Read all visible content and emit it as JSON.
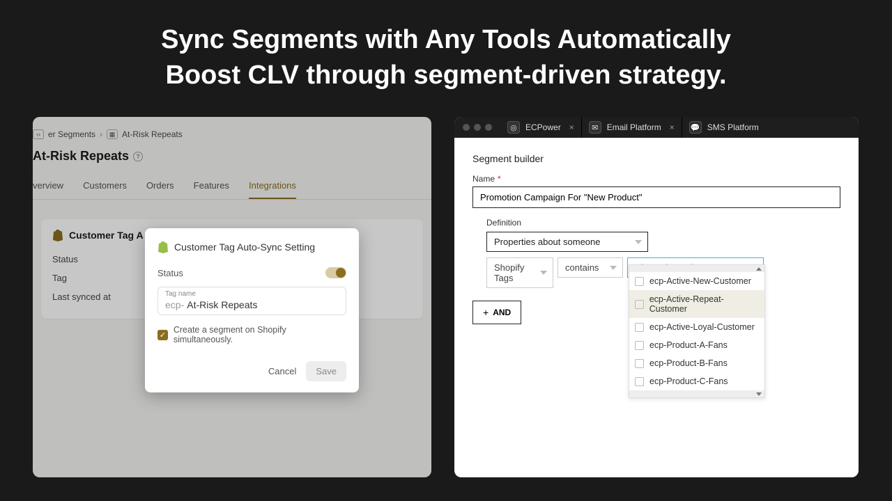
{
  "headline": {
    "line1": "Sync Segments with Any Tools Automatically",
    "line2": "Boost CLV through segment-driven strategy."
  },
  "left": {
    "breadcrumb": {
      "root": "er Segments",
      "current": "At-Risk Repeats"
    },
    "page_title": "At-Risk Repeats",
    "tabs": {
      "overview": "verview",
      "customers": "Customers",
      "orders": "Orders",
      "features": "Features",
      "integrations": "Integrations"
    },
    "card": {
      "title": "Customer Tag A",
      "row_status": "Status",
      "row_tag": "Tag",
      "row_last": "Last synced at"
    },
    "modal": {
      "title": "Customer Tag Auto-Sync Setting",
      "status_label": "Status",
      "tagname_label": "Tag name",
      "tag_prefix": "ecp-",
      "tag_value": "At-Risk Repeats",
      "create_segment": "Create a segment on Shopify simultaneously.",
      "cancel": "Cancel",
      "save": "Save"
    }
  },
  "right": {
    "tabs": {
      "ecpower": "ECPower",
      "email": "Email Platform",
      "sms": "SMS Platform"
    },
    "builder": {
      "title": "Segment builder",
      "name_label": "Name",
      "name_value": "Promotion Campaign For \"New Product\"",
      "definition_label": "Definition",
      "def_select": "Properties about someone",
      "filter_field": "Shopify Tags",
      "filter_op": "contains",
      "dim_placeholder": "Dimension Value",
      "options": [
        "ecp-Active-New-Customer",
        "ecp-Active-Repeat-Customer",
        "ecp-Active-Loyal-Customer",
        "ecp-Product-A-Fans",
        "ecp-Product-B-Fans",
        "ecp-Product-C-Fans"
      ],
      "and": "AND"
    }
  }
}
